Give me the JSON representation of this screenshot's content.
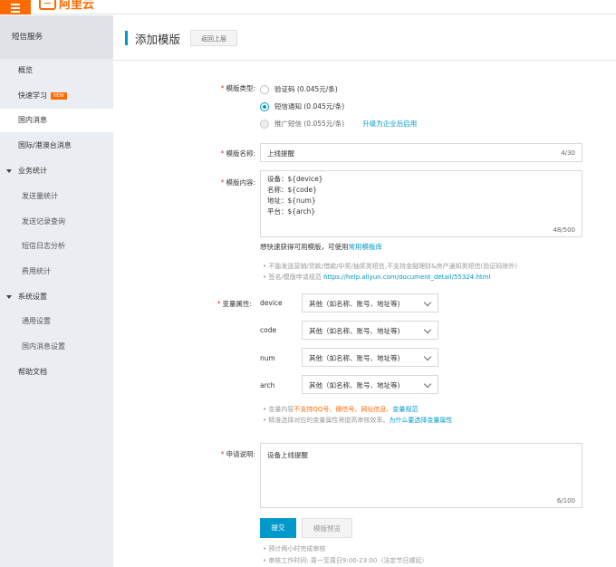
{
  "header": {
    "logo_text": "阿里云"
  },
  "sidebar": {
    "title": "短信服务",
    "items": [
      {
        "label": "概览"
      },
      {
        "label": "快速学习",
        "badge": "NEW"
      },
      {
        "label": "国内消息"
      },
      {
        "label": "国际/港澳台消息"
      },
      {
        "label": "业务统计"
      },
      {
        "label": "发送量统计"
      },
      {
        "label": "发送记录查询"
      },
      {
        "label": "短信日志分析"
      },
      {
        "label": "费用统计"
      },
      {
        "label": "系统设置"
      },
      {
        "label": "通用设置"
      },
      {
        "label": "国内消息设置"
      },
      {
        "label": "帮助文档"
      }
    ]
  },
  "page": {
    "title": "添加模版",
    "back_label": "返回上层"
  },
  "form": {
    "type_label": "模版类型:",
    "types": [
      {
        "label": "验证码 (0.045元/条)"
      },
      {
        "label": "短信通知 (0.045元/条)"
      },
      {
        "label": "推广短信 (0.055元/条)"
      }
    ],
    "upgrade_link": "升级为企业后启用",
    "name_label": "模版名称:",
    "name_value": "上线提醒",
    "name_count": "4/30",
    "content_label": "模版内容:",
    "content_lines": [
      "设备：${device}",
      "名称：${code}",
      "地址：${num}",
      "平台：${arch}"
    ],
    "content_count": "48/500",
    "quick_hint": "想快速获得可用模版，可使用",
    "quick_link": "常用模板库",
    "tip1": "• 不能发送营销/贷款/借款/中奖/抽奖类短信,不支持金融理财&房产通知类短信(验证码除外)",
    "tip2_prefix": "• 签名/模版申请规范 ",
    "tip2_link": "https://help.aliyun.com/document_detail/55324.html",
    "var_label": "变量属性:",
    "variables": [
      {
        "name": "device",
        "value": "其他（如名称、账号、地址等)"
      },
      {
        "name": "code",
        "value": "其他（如名称、账号、地址等)"
      },
      {
        "name": "num",
        "value": "其他（如名称、账号、地址等)"
      },
      {
        "name": "arch",
        "value": "其他（如名称、账号、地址等)"
      }
    ],
    "var_tip1_prefix": "• 变量内容",
    "var_tip1_warn": "不支持QQ号、微信号、网址信息、",
    "var_tip1_link": "变量规范",
    "var_tip2_prefix": "• 精准选择对应的变量属性将提高审核效率。",
    "var_tip2_link": "为什么要选择变量属性",
    "desc_label": "申请说明:",
    "desc_value": "设备上线提醒",
    "desc_count": "6/100",
    "submit_label": "提交",
    "preview_label": "模版预览",
    "review_tip1": "• 预计两小时完成审核",
    "review_tip2": "• 审核工作时间: 周一至周日9:00-23:00（法定节日顺延）"
  },
  "colors": {
    "accent": "#0099cc",
    "brand": "#ff6a00",
    "required": "#ee3333"
  }
}
